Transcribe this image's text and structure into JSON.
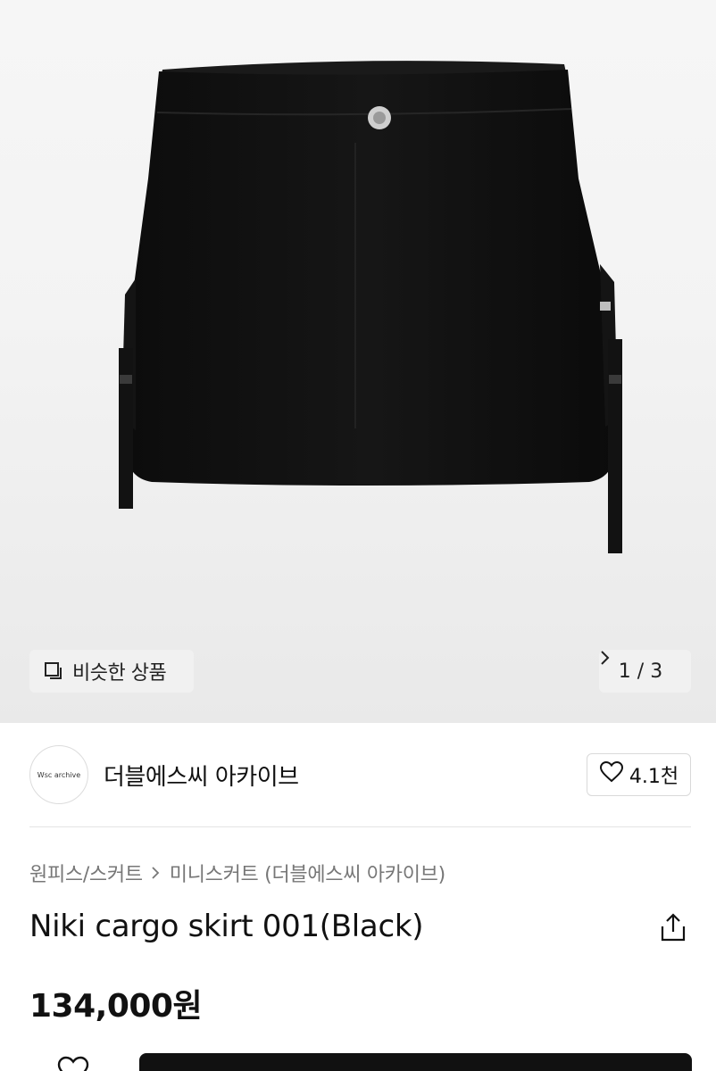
{
  "product_image": {
    "similar_button_label": "비슷한 상품",
    "pager_text": "1 / 3"
  },
  "shop": {
    "avatar_text": "Wsc archive",
    "name": "더블에스씨 아카이브",
    "like_count": "4.1천"
  },
  "breadcrumb": {
    "level1": "원피스/스커트",
    "level2": "미니스커트 (더블에스씨 아카이브)"
  },
  "product": {
    "title": "Niki cargo skirt 001(Black)",
    "price": "134,000원"
  }
}
